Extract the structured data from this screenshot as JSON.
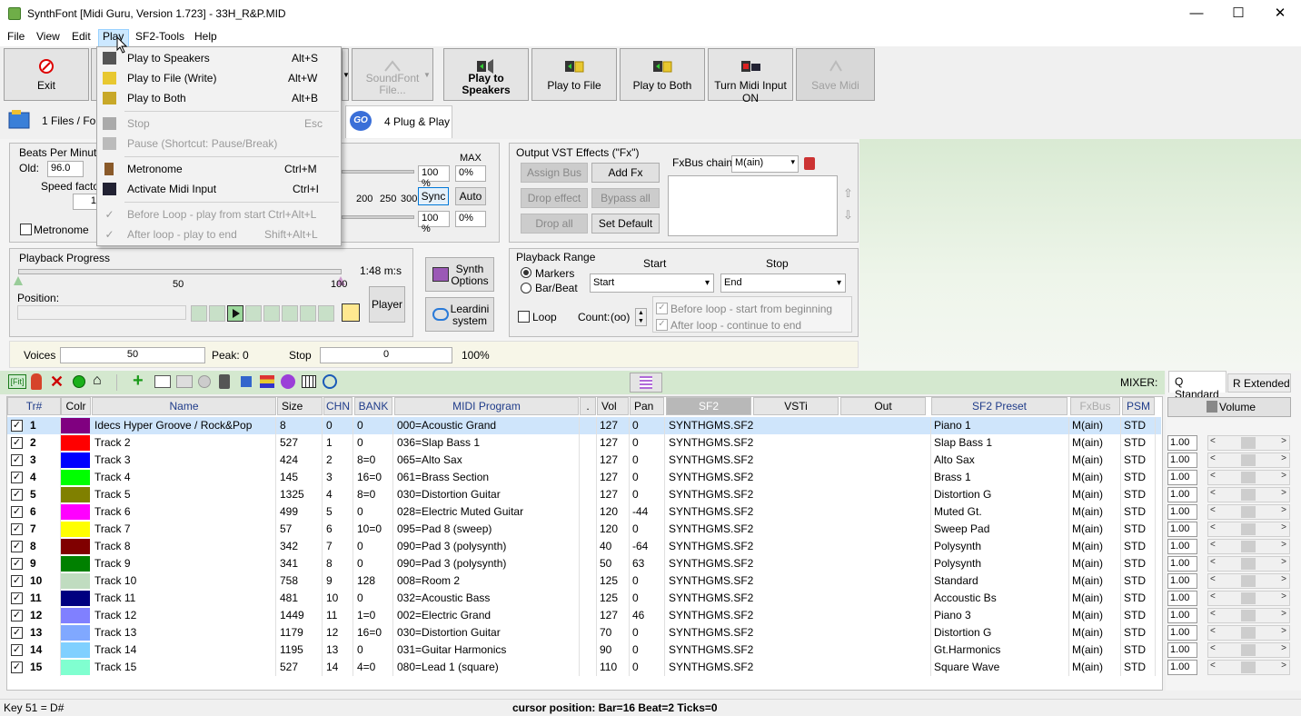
{
  "window": {
    "title": "SynthFont [Midi Guru, Version 1.723] - 33H_R&P.MID",
    "minimize": "—",
    "maximize": "☐",
    "close": "✕"
  },
  "menu": [
    "File",
    "View",
    "Edit",
    "Play",
    "SF2-Tools",
    "Help"
  ],
  "toolbar": {
    "exit": "Exit",
    "soundfont": "SoundFont\nFile...",
    "play_speakers": "Play to\nSpeakers",
    "play_file": "Play to File",
    "play_both": "Play to Both",
    "midi_input": "Turn Midi Input ON",
    "save_midi": "Save Midi"
  },
  "tabs": {
    "files": "1 Files / Folders",
    "plug": "4 Plug & Play"
  },
  "play_menu": {
    "items": [
      {
        "label": "Play to Speakers",
        "shortcut": "Alt+S",
        "enabled": true
      },
      {
        "label": "Play to File (Write)",
        "shortcut": "Alt+W",
        "enabled": true
      },
      {
        "label": "Play to Both",
        "shortcut": "Alt+B",
        "enabled": true
      },
      {
        "label": "Stop",
        "shortcut": "Esc",
        "enabled": false
      },
      {
        "label": "Pause (Shortcut: Pause/Break)",
        "shortcut": "",
        "enabled": false
      },
      {
        "label": "Metronome",
        "shortcut": "Ctrl+M",
        "enabled": true
      },
      {
        "label": "Activate Midi Input",
        "shortcut": "Ctrl+I",
        "enabled": true
      },
      {
        "label": "Before Loop - play from start",
        "shortcut": "Ctrl+Alt+L",
        "enabled": false
      },
      {
        "label": "After loop - play to end",
        "shortcut": "Shift+Alt+L",
        "enabled": false
      }
    ]
  },
  "bpm": {
    "title": "Beats Per Minute",
    "old_label": "Old:",
    "old_value": "96.0",
    "speed_label": "Speed factor",
    "speed_value": "1",
    "metronome": "Metronome"
  },
  "volume_panel": {
    "max_label": "MAX",
    "pct1": "100 %",
    "val1": "0%",
    "ticks": [
      "200",
      "250",
      "300"
    ],
    "sync": "Sync",
    "auto": "Auto",
    "pct2": "100 %",
    "val2": "0%"
  },
  "vst": {
    "title": "Output VST Effects (\"Fx\")",
    "assign_bus": "Assign Bus",
    "add_fx": "Add Fx",
    "drop_effect": "Drop effect",
    "bypass_all": "Bypass all",
    "drop_all": "Drop all",
    "set_default": "Set Default",
    "fxbus_label": "FxBus chain",
    "fxbus_value": "M(ain)"
  },
  "progress": {
    "title": "Playback Progress",
    "time": "1:48 m:s",
    "mark_50": "50",
    "mark_100": "100",
    "position_label": "Position:",
    "player": "Player"
  },
  "synth": {
    "options": "Synth\nOptions",
    "leardini": "Leardini\nsystem"
  },
  "range": {
    "title": "Playback Range",
    "markers": "Markers",
    "barbeat": "Bar/Beat",
    "start_hdr": "Start",
    "stop_hdr": "Stop",
    "start_value": "Start",
    "stop_value": "End",
    "loop": "Loop",
    "count_label": "Count:",
    "count_value": "(oo)",
    "before_loop": "Before loop - start from beginning",
    "after_loop": "After loop - continue to end"
  },
  "voices": {
    "label": "Voices",
    "value": "50",
    "peak": "Peak: 0",
    "stop_label": "Stop",
    "stop_value": "0",
    "pct": "100%"
  },
  "mixer": {
    "label": "MIXER:",
    "tab_q": "Q Standard",
    "tab_r": "R Extended",
    "volume": "Volume",
    "values": [
      "1.00",
      "1.00",
      "1.00",
      "1.00",
      "1.00",
      "1.00",
      "1.00",
      "1.00",
      "1.00",
      "1.00",
      "1.00",
      "1.00",
      "1.00",
      "1.00"
    ]
  },
  "grid_headers": {
    "tr": "Tr#",
    "colr": "Colr",
    "name": "Name",
    "size": "Size",
    "chn": "CHN",
    "bank": "BANK",
    "program": "MIDI Program",
    "dot": ".",
    "vol": "Vol",
    "pan": "Pan",
    "sf2": "SF2",
    "vsti": "VSTi",
    "out": "Out",
    "preset": "SF2 Preset",
    "fxbus": "FxBus",
    "psm": "PSM"
  },
  "tracks": [
    {
      "tr": "1",
      "color": "#800080",
      "name": "Idecs Hyper Groove / Rock&Pop",
      "size": "8",
      "chn": "0",
      "bank": "0",
      "program": "000=Acoustic Grand",
      "vol": "127",
      "pan": "0",
      "sf2": "SYNTHGMS.SF2",
      "preset": "Piano 1",
      "fxbus": "M(ain)",
      "psm": "STD"
    },
    {
      "tr": "2",
      "color": "#ff0000",
      "name": "Track 2",
      "size": "527",
      "chn": "1",
      "bank": "0",
      "program": "036=Slap Bass 1",
      "vol": "127",
      "pan": "0",
      "sf2": "SYNTHGMS.SF2",
      "preset": "Slap Bass 1",
      "fxbus": "M(ain)",
      "psm": "STD"
    },
    {
      "tr": "3",
      "color": "#0000ff",
      "name": "Track 3",
      "size": "424",
      "chn": "2",
      "bank": "8=0",
      "program": "065=Alto Sax",
      "vol": "127",
      "pan": "0",
      "sf2": "SYNTHGMS.SF2",
      "preset": "Alto Sax",
      "fxbus": "M(ain)",
      "psm": "STD"
    },
    {
      "tr": "4",
      "color": "#00ff00",
      "name": "Track 4",
      "size": "145",
      "chn": "3",
      "bank": "16=0",
      "program": "061=Brass Section",
      "vol": "127",
      "pan": "0",
      "sf2": "SYNTHGMS.SF2",
      "preset": "Brass 1",
      "fxbus": "M(ain)",
      "psm": "STD"
    },
    {
      "tr": "5",
      "color": "#808000",
      "name": "Track 5",
      "size": "1325",
      "chn": "4",
      "bank": "8=0",
      "program": "030=Distortion Guitar",
      "vol": "127",
      "pan": "0",
      "sf2": "SYNTHGMS.SF2",
      "preset": "Distortion G",
      "fxbus": "M(ain)",
      "psm": "STD"
    },
    {
      "tr": "6",
      "color": "#ff00ff",
      "name": "Track 6",
      "size": "499",
      "chn": "5",
      "bank": "0",
      "program": "028=Electric Muted Guitar",
      "vol": "120",
      "pan": "-44",
      "sf2": "SYNTHGMS.SF2",
      "preset": "Muted Gt.",
      "fxbus": "M(ain)",
      "psm": "STD"
    },
    {
      "tr": "7",
      "color": "#ffff00",
      "name": "Track 7",
      "size": "57",
      "chn": "6",
      "bank": "10=0",
      "program": "095=Pad 8 (sweep)",
      "vol": "120",
      "pan": "0",
      "sf2": "SYNTHGMS.SF2",
      "preset": "Sweep Pad",
      "fxbus": "M(ain)",
      "psm": "STD"
    },
    {
      "tr": "8",
      "color": "#800000",
      "name": "Track 8",
      "size": "342",
      "chn": "7",
      "bank": "0",
      "program": "090=Pad 3 (polysynth)",
      "vol": "40",
      "pan": "-64",
      "sf2": "SYNTHGMS.SF2",
      "preset": "Polysynth",
      "fxbus": "M(ain)",
      "psm": "STD"
    },
    {
      "tr": "9",
      "color": "#008000",
      "name": "Track 9",
      "size": "341",
      "chn": "8",
      "bank": "0",
      "program": "090=Pad 3 (polysynth)",
      "vol": "50",
      "pan": "63",
      "sf2": "SYNTHGMS.SF2",
      "preset": "Polysynth",
      "fxbus": "M(ain)",
      "psm": "STD"
    },
    {
      "tr": "10",
      "color": "#c0dcc0",
      "name": "Track 10",
      "size": "758",
      "chn": "9",
      "bank": "128",
      "program": "008=Room 2",
      "vol": "125",
      "pan": "0",
      "sf2": "SYNTHGMS.SF2",
      "preset": "Standard",
      "fxbus": "M(ain)",
      "psm": "STD"
    },
    {
      "tr": "11",
      "color": "#000080",
      "name": "Track 11",
      "size": "481",
      "chn": "10",
      "bank": "0",
      "program": "032=Acoustic Bass",
      "vol": "125",
      "pan": "0",
      "sf2": "SYNTHGMS.SF2",
      "preset": "Accoustic Bs",
      "fxbus": "M(ain)",
      "psm": "STD"
    },
    {
      "tr": "12",
      "color": "#8080ff",
      "name": "Track 12",
      "size": "1449",
      "chn": "11",
      "bank": "1=0",
      "program": "002=Electric Grand",
      "vol": "127",
      "pan": "46",
      "sf2": "SYNTHGMS.SF2",
      "preset": "Piano 3",
      "fxbus": "M(ain)",
      "psm": "STD"
    },
    {
      "tr": "13",
      "color": "#80a8ff",
      "name": "Track 13",
      "size": "1179",
      "chn": "12",
      "bank": "16=0",
      "program": "030=Distortion Guitar",
      "vol": "70",
      "pan": "0",
      "sf2": "SYNTHGMS.SF2",
      "preset": "Distortion G",
      "fxbus": "M(ain)",
      "psm": "STD"
    },
    {
      "tr": "14",
      "color": "#80d0ff",
      "name": "Track 14",
      "size": "1195",
      "chn": "13",
      "bank": "0",
      "program": "031=Guitar Harmonics",
      "vol": "90",
      "pan": "0",
      "sf2": "SYNTHGMS.SF2",
      "preset": "Gt.Harmonics",
      "fxbus": "M(ain)",
      "psm": "STD"
    },
    {
      "tr": "15",
      "color": "#80ffd0",
      "name": "Track 15",
      "size": "527",
      "chn": "14",
      "bank": "4=0",
      "program": "080=Lead 1 (square)",
      "vol": "110",
      "pan": "0",
      "sf2": "SYNTHGMS.SF2",
      "preset": "Square Wave",
      "fxbus": "M(ain)",
      "psm": "STD"
    }
  ],
  "status": {
    "key": "Key 51 = D#",
    "cursor": "cursor position: Bar=16 Beat=2 Ticks=0"
  }
}
